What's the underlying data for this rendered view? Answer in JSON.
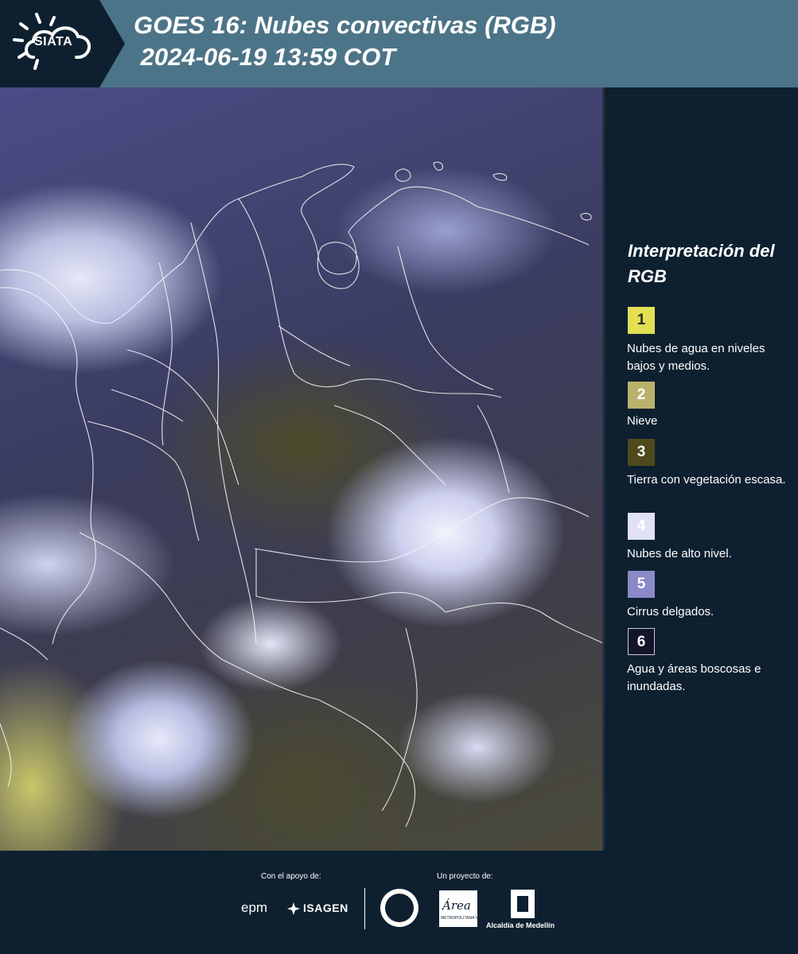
{
  "header": {
    "logo_text": "SIATA",
    "title": "GOES 16: Nubes convectivas (RGB)\n 2024-06-19 13:59 COT"
  },
  "legend": {
    "title": "Interpretación del RGB",
    "items": [
      {
        "num": "1",
        "label": "Nubes de agua en niveles bajos y medios.",
        "color": "#e3df55"
      },
      {
        "num": "2",
        "label": "Nieve",
        "color": "#bab26b"
      },
      {
        "num": "3",
        "label": "Tierra con vegetación escasa.",
        "color": "#4f4a1e"
      },
      {
        "num": "4",
        "label": "Nubes de alto nivel.",
        "color": "#e1e1f5"
      },
      {
        "num": "5",
        "label": "Cirrus delgados.",
        "color": "#8c89c9"
      },
      {
        "num": "6",
        "label": "Agua y áreas boscosas e inundadas.",
        "color": "#14142a"
      }
    ]
  },
  "footer": {
    "support_label": "Con el apoyo de:",
    "project_label": "Un proyecto de:",
    "epm": "epm",
    "isagen": "ISAGEN",
    "amva_word": "Área",
    "amva_sub": "METROPOLITANA Valle de Aburrá",
    "alcaldia": "Alcaldía de Medellín"
  }
}
